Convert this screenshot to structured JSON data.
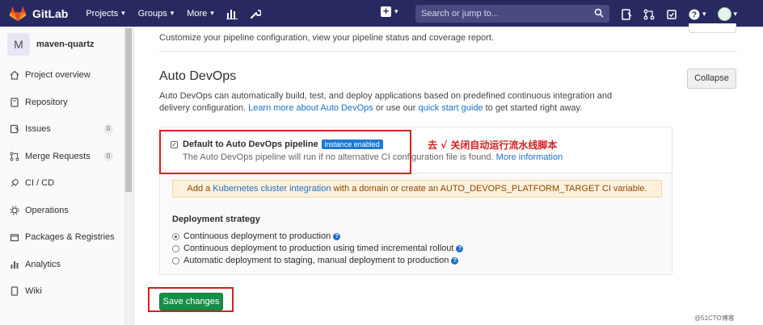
{
  "topnav": {
    "brand": "GitLab",
    "projects_label": "Projects",
    "groups_label": "Groups",
    "more_label": "More",
    "search_placeholder": "Search or jump to..."
  },
  "sidebar": {
    "project_initial": "M",
    "project_name": "maven-quartz",
    "items": [
      {
        "label": "Project overview"
      },
      {
        "label": "Repository"
      },
      {
        "label": "Issues",
        "count": "0"
      },
      {
        "label": "Merge Requests",
        "count": "0"
      },
      {
        "label": "CI / CD"
      },
      {
        "label": "Operations"
      },
      {
        "label": "Packages & Registries"
      },
      {
        "label": "Analytics"
      },
      {
        "label": "Wiki"
      }
    ]
  },
  "main": {
    "intro_text": "Customize your pipeline configuration, view your pipeline status and coverage report.",
    "section_title": "Auto DevOps",
    "collapse_label": "Collapse",
    "desc_1": "Auto DevOps can automatically build, test, and deploy applications based on predefined continuous integration and delivery configuration.",
    "desc_link_1": "Learn more about Auto DevOps",
    "desc_2": "or use our",
    "desc_link_2": "quick start guide",
    "desc_3": "to get started right away.",
    "checkbox_label": "Default to Auto DevOps pipeline",
    "checkbox_badge": "instance enabled",
    "help_text": "The Auto DevOps pipeline will run if no alternative CI configuration file is found.",
    "help_link": "More information",
    "warning_pre": "Add a",
    "warning_link": "Kubernetes cluster integration",
    "warning_post": "with a domain or create an AUTO_DEVOPS_PLATFORM_TARGET CI variable.",
    "strategy_title": "Deployment strategy",
    "strategies": [
      {
        "label": "Continuous deployment to production",
        "selected": true
      },
      {
        "label": "Continuous deployment to production using timed incremental rollout",
        "selected": false
      },
      {
        "label": "Automatic deployment to staging, manual deployment to production",
        "selected": false
      }
    ],
    "save_label": "Save changes"
  },
  "annotation_text": "去 √ 关闭自动运行流水线脚本",
  "watermark": "@51CTO博客"
}
